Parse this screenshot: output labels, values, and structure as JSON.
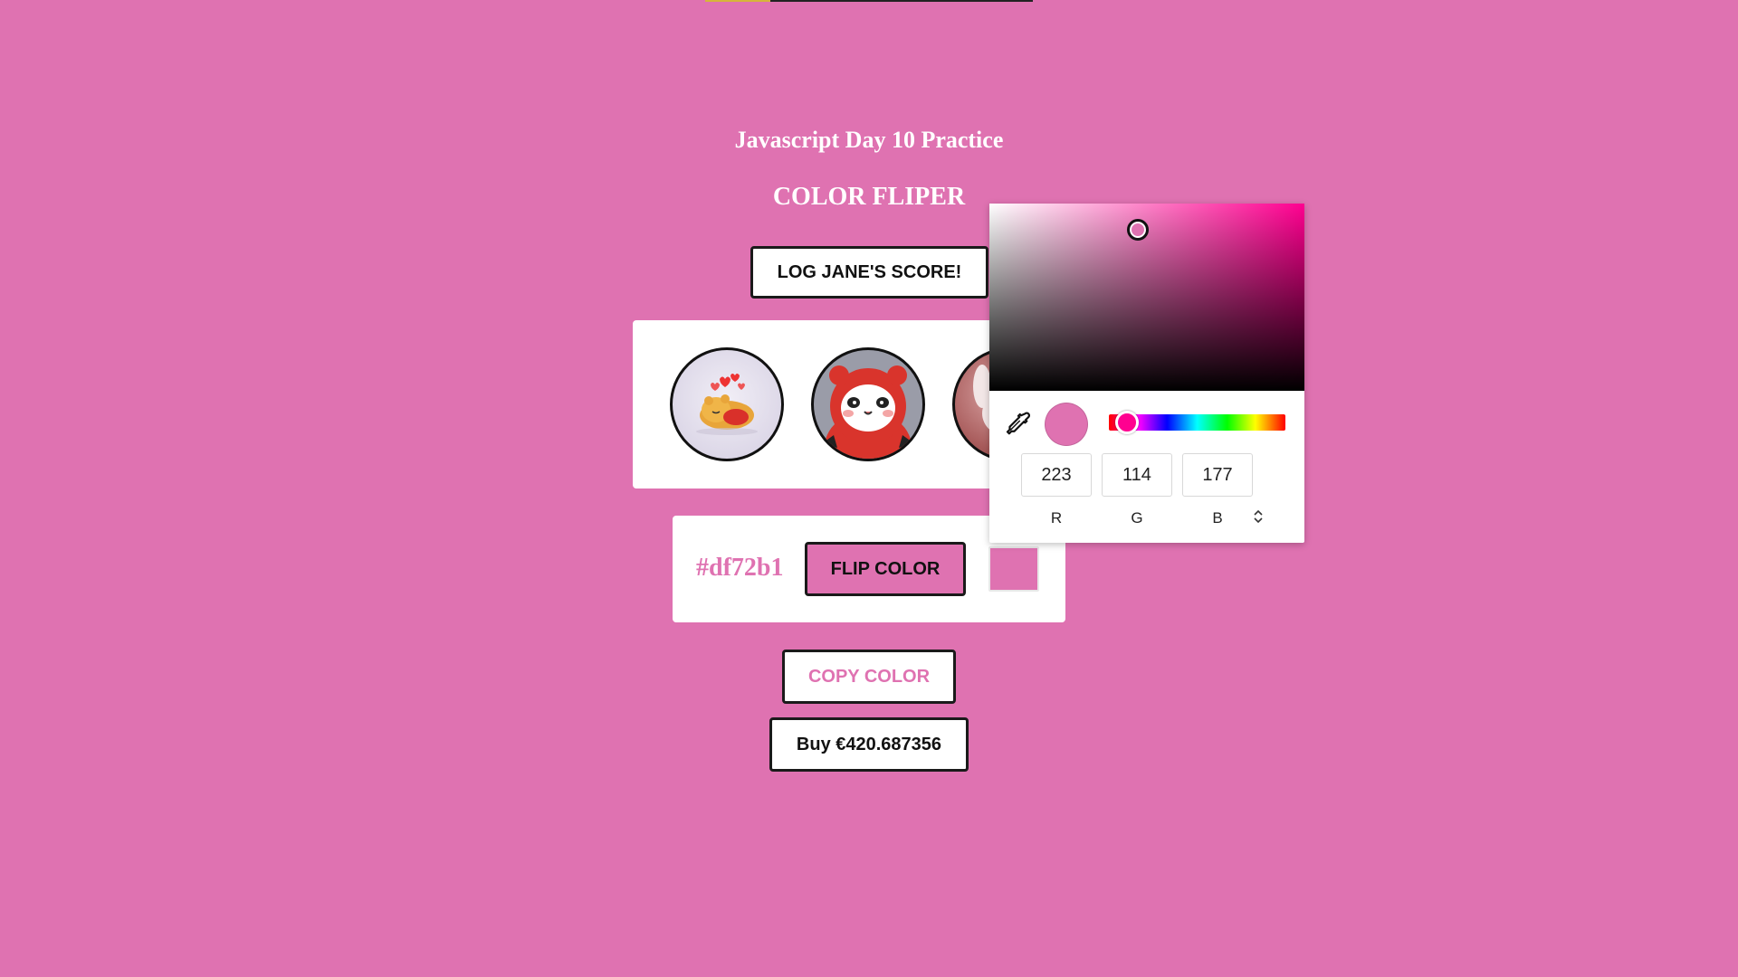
{
  "page": {
    "title": "Javascript Day 10 Practice",
    "subtitle": "COLOR FLIPER",
    "background": "#df72b1",
    "progress_fraction": 0.2
  },
  "buttons": {
    "score_label": "LOG JANE'S SCORE!",
    "flip_label": "FLIP COLOR",
    "copy_label": "COPY COLOR",
    "buy_label": "Buy €420.687356"
  },
  "avatars": [
    {
      "icon": "winnie-the-pooh-sleeping-avatar"
    },
    {
      "icon": "panda-in-red-hood-avatar"
    },
    {
      "icon": "bunny-avatar"
    }
  ],
  "color_card": {
    "hex": "#df72b1",
    "swatch_color": "#df72b1"
  },
  "color_picker": {
    "r": "223",
    "g": "114",
    "b": "177",
    "r_label": "R",
    "g_label": "G",
    "b_label": "B",
    "hue_color": "#ff0090",
    "eyedropper_icon": "eyedropper-icon",
    "mode_toggle_icon": "up-down-chevron-icon"
  }
}
